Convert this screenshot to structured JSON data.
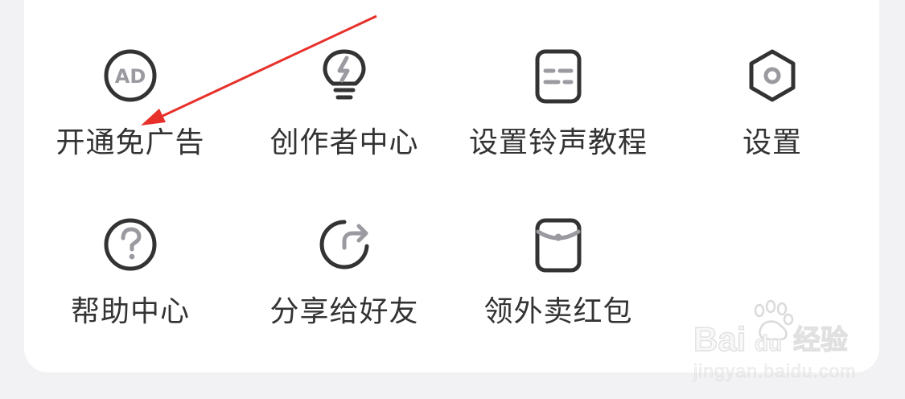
{
  "menu": {
    "items": [
      {
        "label": "开通免广告",
        "icon": "ad-icon"
      },
      {
        "label": "创作者中心",
        "icon": "lightbulb-icon"
      },
      {
        "label": "设置铃声教程",
        "icon": "ringtone-settings-icon"
      },
      {
        "label": "设置",
        "icon": "hexagon-settings-icon"
      },
      {
        "label": "帮助中心",
        "icon": "help-icon"
      },
      {
        "label": "分享给好友",
        "icon": "share-icon"
      },
      {
        "label": "领外卖红包",
        "icon": "red-packet-icon"
      }
    ]
  },
  "watermark": {
    "logo_text": "Baidu经验",
    "url": "jingyan.baidu.com"
  },
  "colors": {
    "icon_stroke": "#333333",
    "icon_accent": "#9a9aa0",
    "label": "#333333",
    "annotation_arrow": "#e8302a",
    "background": "#f2f2f4",
    "card": "#ffffff"
  }
}
